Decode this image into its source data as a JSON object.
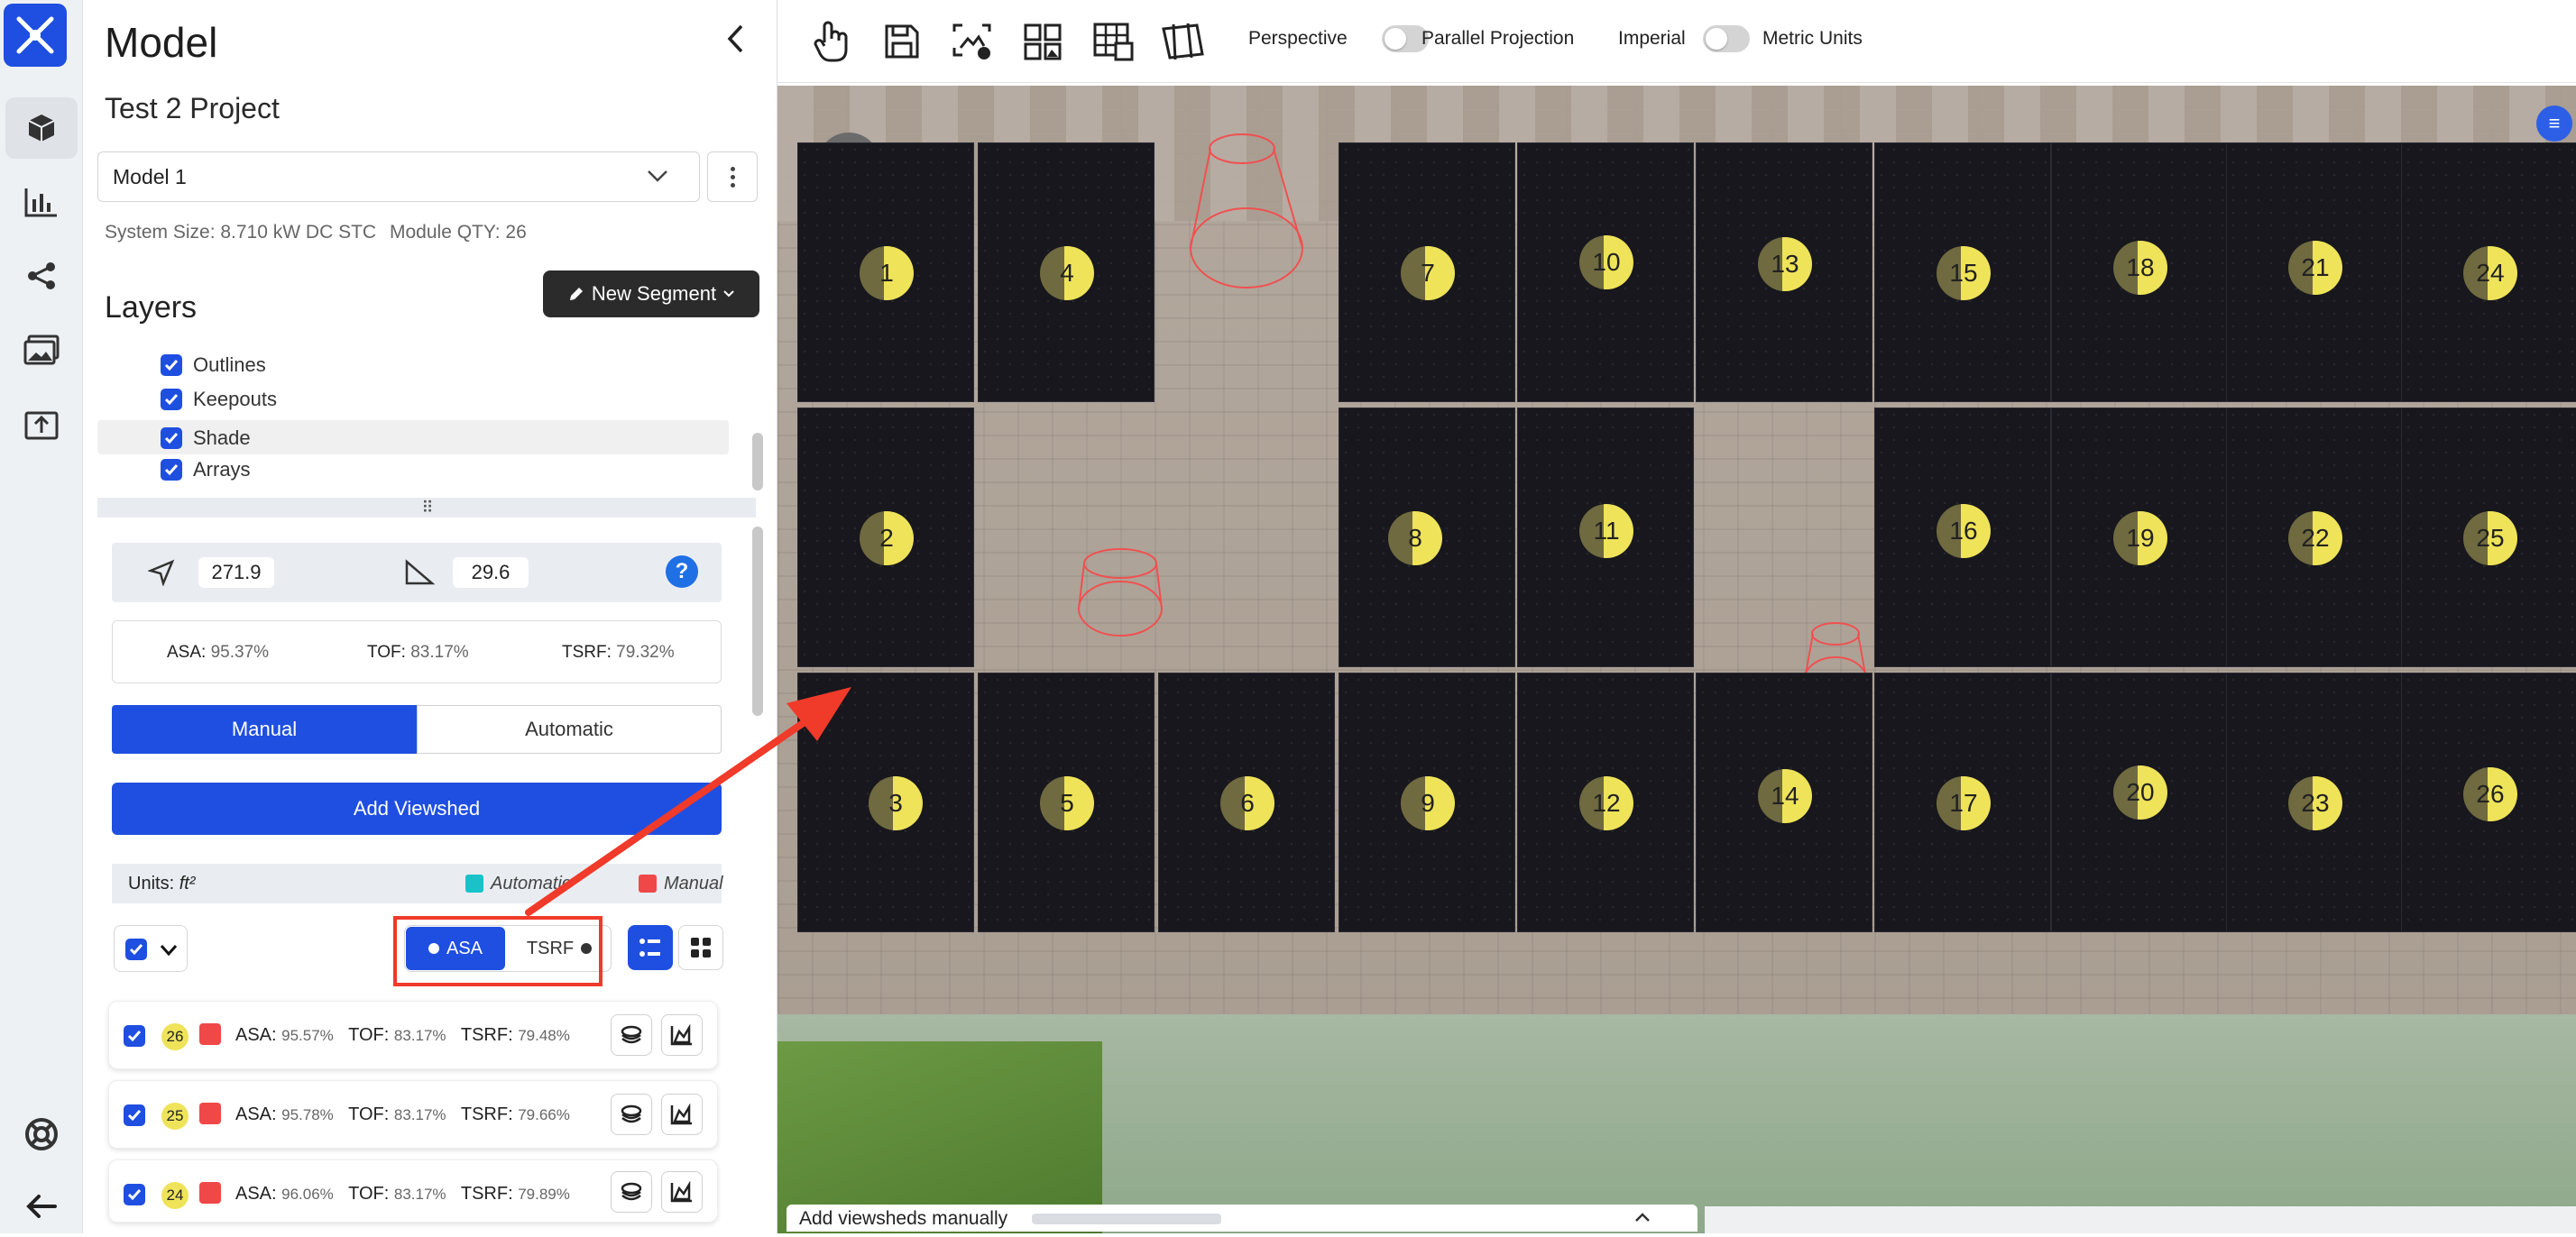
{
  "panel": {
    "title": "Model",
    "project": "Test 2 Project",
    "model_select": "Model 1",
    "system_size": "System Size: 8.710 kW DC STC",
    "module_qty": "Module QTY: 26",
    "layers_title": "Layers",
    "new_segment": "New Segment",
    "layers": [
      "Outlines",
      "Keepouts",
      "Shade",
      "Arrays"
    ],
    "azimuth": "271.9",
    "tilt": "29.6",
    "summary": {
      "asa_label": "ASA:",
      "asa": "95.37%",
      "tof_label": "TOF:",
      "tof": "83.17%",
      "tsrf_label": "TSRF:",
      "tsrf": "79.32%"
    },
    "mode_tabs": [
      "Manual",
      "Automatic"
    ],
    "add_viewshed": "Add Viewshed",
    "units_label": "Units:",
    "units_value": "ft²",
    "legend_auto": "Automatic",
    "legend_manual": "Manual",
    "sort_asa": "ASA",
    "sort_tsrf": "TSRF",
    "rows": [
      {
        "num": "26",
        "asa_label": "ASA:",
        "asa": "95.57%",
        "tof_label": "TOF:",
        "tof": "83.17%",
        "tsrf_label": "TSRF:",
        "tsrf": "79.48%"
      },
      {
        "num": "25",
        "asa_label": "ASA:",
        "asa": "95.78%",
        "tof_label": "TOF:",
        "tof": "83.17%",
        "tsrf_label": "TSRF:",
        "tsrf": "79.66%"
      },
      {
        "num": "24",
        "asa_label": "ASA:",
        "asa": "96.06%",
        "tof_label": "TOF:",
        "tof": "83.17%",
        "tsrf_label": "TSRF:",
        "tsrf": "79.89%"
      }
    ]
  },
  "toolbar": {
    "perspective": "Perspective",
    "parallel": "Parallel Projection",
    "imperial": "Imperial",
    "metric": "Metric Units"
  },
  "viewer": {
    "status": "Add viewsheds manually",
    "modules": [
      "1",
      "2",
      "3",
      "4",
      "5",
      "6",
      "7",
      "8",
      "9",
      "10",
      "11",
      "12",
      "13",
      "14",
      "15",
      "16",
      "17",
      "18",
      "19",
      "20",
      "21",
      "22",
      "23",
      "24",
      "25",
      "26"
    ]
  },
  "colors": {
    "accent": "#1f4fe0",
    "annotation": "#f03a2a",
    "module": "#17171d",
    "sun": "#efe35a",
    "manual": "#f04848",
    "automatic": "#19c2c9"
  }
}
